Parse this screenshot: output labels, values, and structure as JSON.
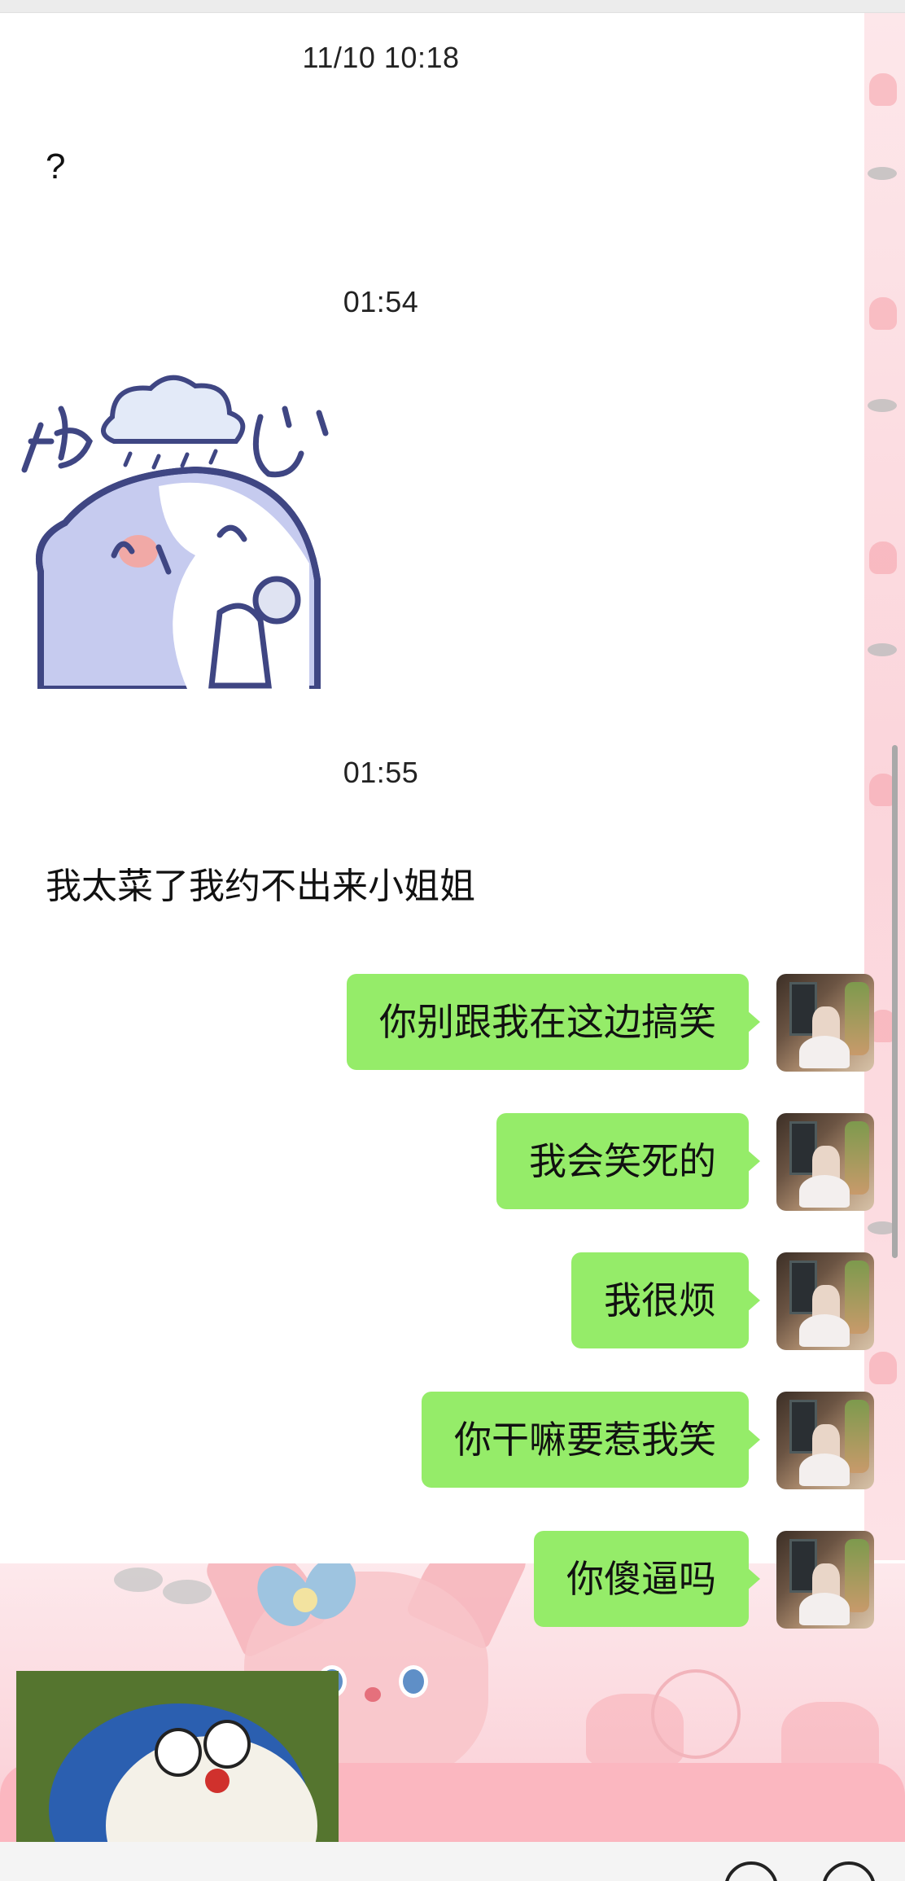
{
  "timestamps": [
    "11/10 10:18",
    "01:54",
    "01:55"
  ],
  "received": {
    "msg1": "?",
    "msg2": "我太菜了我约不出来小姐姐"
  },
  "sticker": {
    "text": "伤心",
    "icon": "sad-rabbit-sticker"
  },
  "sent": [
    {
      "text": "你别跟我在这边搞笑"
    },
    {
      "text": "我会笑死的"
    },
    {
      "text": "我很烦"
    },
    {
      "text": "你干嘛要惹我笑"
    },
    {
      "text": "你傻逼吗"
    }
  ],
  "colors": {
    "sent_bubble": "#95ec69",
    "wallpaper_pink": "#fbd6dc"
  },
  "icons": {
    "avatar": "user-avatar-photo",
    "thumbnail": "doraemon-image-thumbnail"
  }
}
